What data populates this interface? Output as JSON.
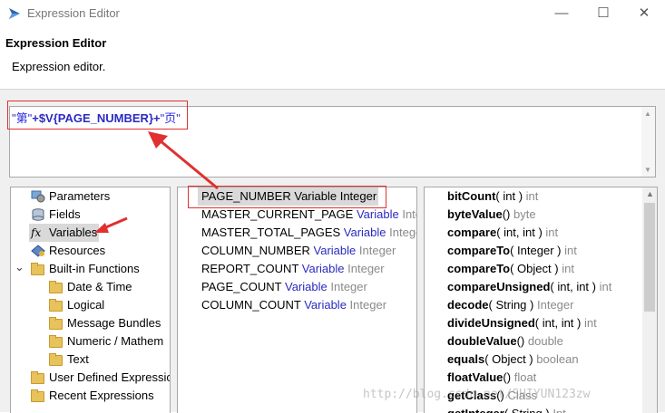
{
  "window": {
    "title": "Expression Editor",
    "minimize": "—",
    "maximize": "☐",
    "close": "✕"
  },
  "header": {
    "title": "Expression Editor",
    "subtitle": "Expression editor."
  },
  "expression": {
    "part1": "\"第\"",
    "plus1": "+",
    "var": "$V{PAGE_NUMBER}",
    "plus2": "+",
    "part2": "\"页\""
  },
  "categories": [
    {
      "label": "Parameters",
      "icon": "parameters-icon"
    },
    {
      "label": "Fields",
      "icon": "fields-icon"
    },
    {
      "label": "Variables",
      "icon": "fx-icon",
      "glyph": "fx"
    },
    {
      "label": "Resources",
      "icon": "resources-icon"
    },
    {
      "label": "Built-in Functions",
      "icon": "folder-icon",
      "toggle": "⌄"
    },
    {
      "label": "Date & Time",
      "icon": "folder-icon"
    },
    {
      "label": "Logical",
      "icon": "folder-icon"
    },
    {
      "label": "Message Bundles",
      "icon": "folder-icon"
    },
    {
      "label": "Numeric / Mathem",
      "icon": "folder-icon"
    },
    {
      "label": "Text",
      "icon": "folder-icon"
    },
    {
      "label": "User Defined Expressic",
      "icon": "folder-icon"
    },
    {
      "label": "Recent Expressions",
      "icon": "folder-icon"
    }
  ],
  "variables": [
    {
      "name": "PAGE_NUMBER",
      "kind": "Variable",
      "type": "Integer"
    },
    {
      "name": "MASTER_CURRENT_PAGE",
      "kind": "Variable",
      "type": "Intege"
    },
    {
      "name": "MASTER_TOTAL_PAGES",
      "kind": "Variable",
      "type": "Integer"
    },
    {
      "name": "COLUMN_NUMBER",
      "kind": "Variable",
      "type": "Integer"
    },
    {
      "name": "REPORT_COUNT",
      "kind": "Variable",
      "type": "Integer"
    },
    {
      "name": "PAGE_COUNT",
      "kind": "Variable",
      "type": "Integer"
    },
    {
      "name": "COLUMN_COUNT",
      "kind": "Variable",
      "type": "Integer"
    }
  ],
  "methods": [
    {
      "name": "bitCount",
      "args": "( int )",
      "ret": "int"
    },
    {
      "name": "byteValue",
      "args": "()",
      "ret": "byte"
    },
    {
      "name": "compare",
      "args": "( int, int )",
      "ret": "int"
    },
    {
      "name": "compareTo",
      "args": "( Integer )",
      "ret": "int"
    },
    {
      "name": "compareTo",
      "args": "( Object )",
      "ret": "int"
    },
    {
      "name": "compareUnsigned",
      "args": "( int, int )",
      "ret": "int"
    },
    {
      "name": "decode",
      "args": "( String )",
      "ret": "Integer"
    },
    {
      "name": "divideUnsigned",
      "args": "( int, int )",
      "ret": "int"
    },
    {
      "name": "doubleValue",
      "args": "()",
      "ret": "double"
    },
    {
      "name": "equals",
      "args": "( Object )",
      "ret": "boolean"
    },
    {
      "name": "floatValue",
      "args": "()",
      "ret": "float"
    },
    {
      "name": "getClass",
      "args": "()",
      "ret": "Class"
    },
    {
      "name": "getInteger",
      "args": "( String )",
      "ret": "Int"
    }
  ],
  "watermark": "http://blog.csdn.net/SHIYUN123zw",
  "colors": {
    "variable_blue": "#2b2bc0",
    "annotation_red": "#e03030",
    "muted_gray": "#8a8a8a"
  }
}
